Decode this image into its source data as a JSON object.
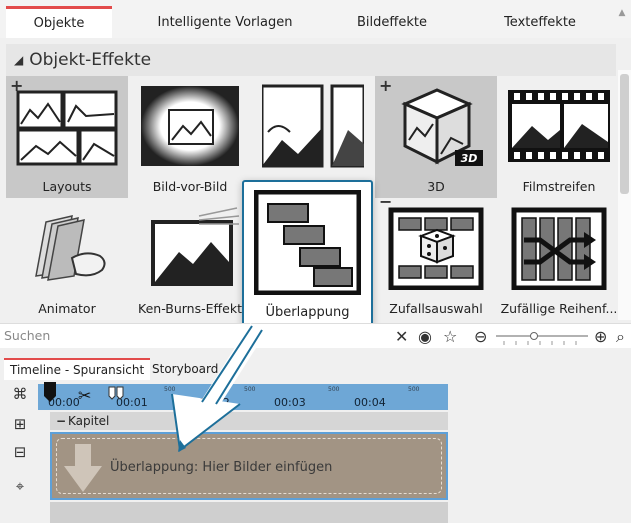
{
  "tabs": [
    "Objekte",
    "Intelligente Vorlagen",
    "Bildeffekte",
    "Texteffekte"
  ],
  "section_title": "Objekt-Effekte",
  "effects_row1": [
    "Layouts",
    "Bild-vor-Bild",
    "",
    "3D",
    "Filmstreifen"
  ],
  "effects_row2": [
    "Animator",
    "Ken-Burns-Effekt",
    "Überlappung",
    "Zufallsauswahl",
    "Zufällige Reihenf..."
  ],
  "badge_3d": "3D",
  "search": {
    "placeholder": "Suchen"
  },
  "bottom_tabs": [
    "Timeline - Spuransicht",
    "Storyboard"
  ],
  "ruler_ticks": [
    "00:00",
    "00:01",
    "00:02",
    "00:03",
    "00:04"
  ],
  "ruler_minor": [
    "500",
    "500",
    "500",
    "500",
    "500"
  ],
  "chapter_label": "Kapitel",
  "drop_hint": "Überlappung: Hier Bilder einfügen",
  "colors": {
    "accent": "#e24b4b",
    "selection_border": "#1d6f9a",
    "ruler": "#6ea7d6",
    "track": "#a29484"
  }
}
